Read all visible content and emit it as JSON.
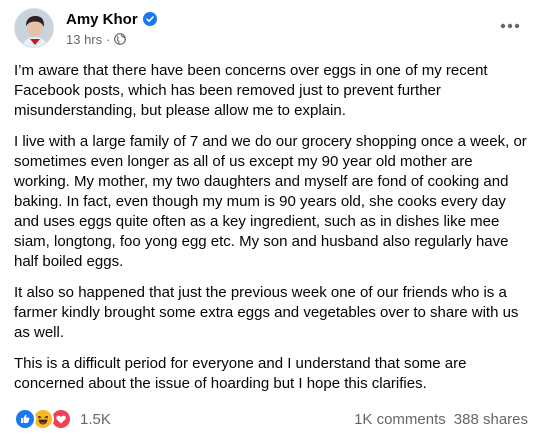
{
  "post": {
    "author": "Amy Khor",
    "time": "13 hrs",
    "separator": "·",
    "paragraphs": [
      "I’m aware that there have been concerns over eggs in one of my recent Facebook posts, which has been removed just to prevent further misunderstanding, but please allow me to explain.",
      "I live with a large family of 7 and we do our grocery shopping once a week, or sometimes even longer as all of us except my 90 year old mother are working. My mother, my two daughters and myself are fond of cooking and baking. In fact, even though my mum is 90 years old, she cooks every day and uses eggs quite often as a key ingredient, such as in dishes like mee siam, longtong, foo yong egg etc. My son and husband also regularly have half boiled eggs.",
      "It also so happened that just the previous week one of our friends who is a  farmer kindly brought some extra eggs and vegetables over to share with us as well.",
      "This is a difficult period for everyone and I understand that some are concerned about the issue of hoarding but I hope this clarifies."
    ]
  },
  "footer": {
    "reaction_count": "1.5K",
    "comments": "1K comments",
    "shares": "388 shares",
    "reactions": [
      "like-icon",
      "haha-icon",
      "love-icon"
    ]
  },
  "icons": {
    "verified": "verified-badge-icon",
    "privacy": "globe-icon",
    "more": "more-options-icon"
  },
  "colors": {
    "like": "#1877f2",
    "haha": "#f7b928",
    "love": "#f33e58",
    "secondary_text": "#65676b",
    "text": "#050505"
  }
}
